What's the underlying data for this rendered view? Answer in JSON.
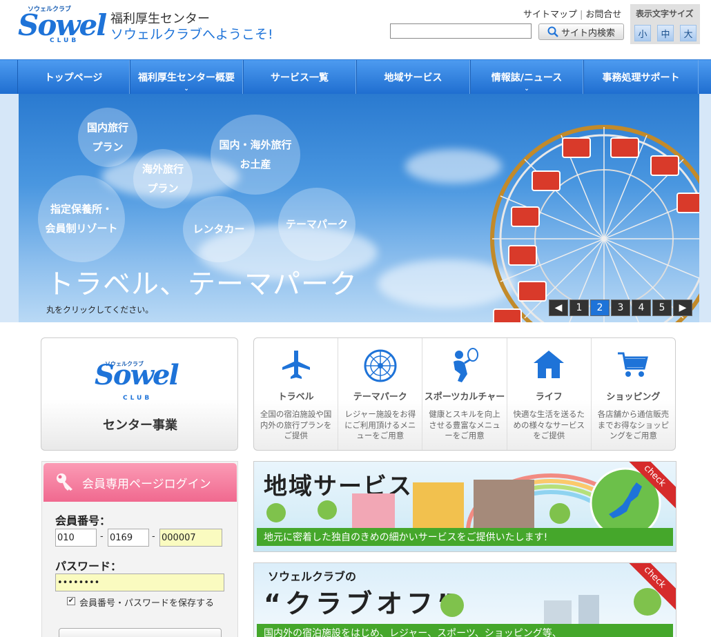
{
  "header": {
    "logo_small": "ソウェルクラブ",
    "logo_main": "Sowel",
    "logo_sub": "CLUB",
    "welcome_line1": "福利厚生センター",
    "welcome_line2": "ソウェルクラブへようこそ!",
    "link_sitemap": "サイトマップ",
    "link_separator": "|",
    "link_contact": "お問合せ",
    "search_placeholder": "",
    "search_button": "サイト内検索",
    "fontsize_label": "表示文字サイズ",
    "fontsize_small": "小",
    "fontsize_medium": "中",
    "fontsize_large": "大"
  },
  "nav": {
    "items": [
      {
        "label": "トップページ",
        "has_dropdown": false
      },
      {
        "label": "福利厚生センター概要",
        "has_dropdown": true
      },
      {
        "label": "サービス一覧",
        "has_dropdown": false
      },
      {
        "label": "地域サービス",
        "has_dropdown": false
      },
      {
        "label": "情報誌/ニュース",
        "has_dropdown": true
      },
      {
        "label": "事務処理サポート",
        "has_dropdown": false
      }
    ],
    "chevron": "⌄"
  },
  "banner": {
    "bubbles": {
      "domestic_1": "国内旅行",
      "domestic_2": "プラン",
      "overseas_1": "海外旅行",
      "overseas_2": "プラン",
      "souvenir_1": "国内・海外旅行",
      "souvenir_2": "お土産",
      "resort_1": "指定保養所・",
      "resort_2": "会員制リゾート",
      "rental": "レンタカー",
      "themepark": "テーマパーク"
    },
    "title": "トラベル、テーマパーク",
    "note": "丸をクリックしてください。",
    "pager": {
      "prev": "◀",
      "next": "▶",
      "pages": [
        "1",
        "2",
        "3",
        "4",
        "5"
      ],
      "active_page": "2"
    }
  },
  "center_box": {
    "logo_small": "ソウェルクラブ",
    "logo_main": "Sowel",
    "logo_sub": "CLUB",
    "title": "センター事業"
  },
  "categories": [
    {
      "icon": "airplane-icon",
      "title": "トラベル",
      "desc": "全国の宿泊施設や国内外の旅行プランをご提供"
    },
    {
      "icon": "ferris-wheel-icon",
      "title": "テーマパーク",
      "desc": "レジャー施設をお得にご利用頂けるメニューをご用意"
    },
    {
      "icon": "tennis-player-icon",
      "title": "スポーツカルチャー",
      "desc": "健康とスキルを向上させる豊富なメニューをご用意"
    },
    {
      "icon": "house-icon",
      "title": "ライフ",
      "desc": "快適な生活を送るための様々なサービスをご提供"
    },
    {
      "icon": "shopping-cart-icon",
      "title": "ショッピング",
      "desc": "各店舗から通信販売までお得なショッピングをご用意"
    }
  ],
  "login": {
    "heading": "会員専用ページログイン",
    "member_label": "会員番号：",
    "member_part1": "010",
    "member_part2": "0169",
    "member_part3": "000007",
    "dash": "-",
    "password_label": "パスワード：",
    "password_value": "••••••••",
    "remember_checked": "✔",
    "remember_label": "会員番号・パスワードを保存する"
  },
  "promo_regional": {
    "title": "地域サービス",
    "strip": "地元に密着した独自のきめの細かいサービスをご提供いたします!",
    "check": "check"
  },
  "promo_club_off": {
    "subtitle": "ソウェルクラブの",
    "title": "“クラブオフ”",
    "strip": "国内外の宿泊施設をはじめ、レジャー、スポーツ、ショッピング等、",
    "check": "check"
  },
  "colors": {
    "brand_blue": "#1e73d8",
    "nav_top": "#4d9bf0",
    "nav_bottom": "#1f6ed0",
    "login_pink": "#f0698f",
    "promo_green": "#45a72b",
    "check_red": "#d62b2b"
  }
}
